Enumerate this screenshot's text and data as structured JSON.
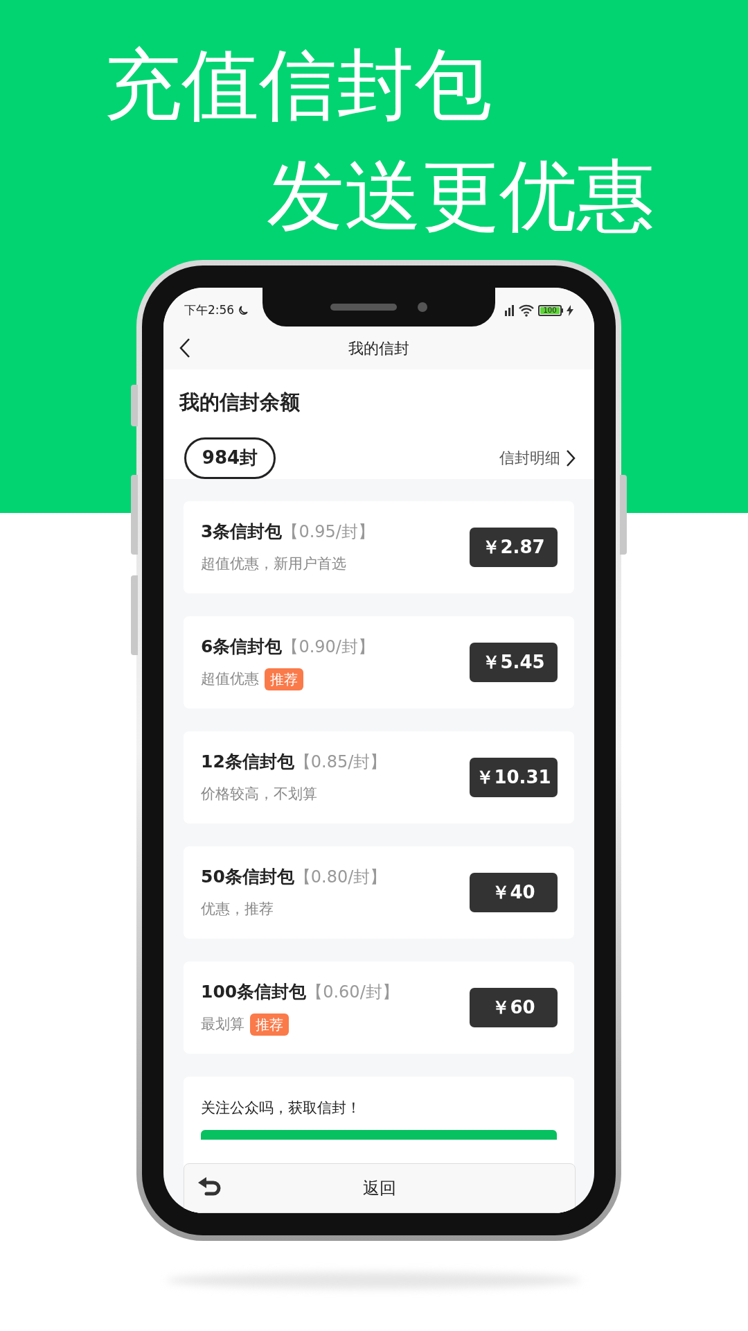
{
  "headline": {
    "line_1": "充值信封包",
    "line_2": "发送更优惠"
  },
  "status_bar": {
    "time": "下午2:56",
    "battery": "100"
  },
  "nav": {
    "title": "我的信封"
  },
  "balance": {
    "heading": "我的信封余额",
    "amount": "984封",
    "detail_link": "信封明细"
  },
  "packages": [
    {
      "title": "3条信封包",
      "unit_price": "【0.95/封】",
      "subtitle": "超值优惠，新用户首选",
      "price": "￥2.87"
    },
    {
      "title": "6条信封包",
      "unit_price": "【0.90/封】",
      "subtitle": "超值优惠",
      "tag": "推荐",
      "price": "￥5.45"
    },
    {
      "title": "12条信封包",
      "unit_price": "【0.85/封】",
      "subtitle": "价格较高，不划算",
      "price": "￥10.31"
    },
    {
      "title": "50条信封包",
      "unit_price": "【0.80/封】",
      "subtitle": "优惠，推荐",
      "price": "￥40"
    },
    {
      "title": "100条信封包",
      "unit_price": "【0.60/封】",
      "subtitle": "最划算",
      "tag": "推荐",
      "price": "￥60"
    }
  ],
  "follow_card": {
    "text": "关注公众吗，获取信封！"
  },
  "bottom_bar": {
    "label": "返回"
  }
}
